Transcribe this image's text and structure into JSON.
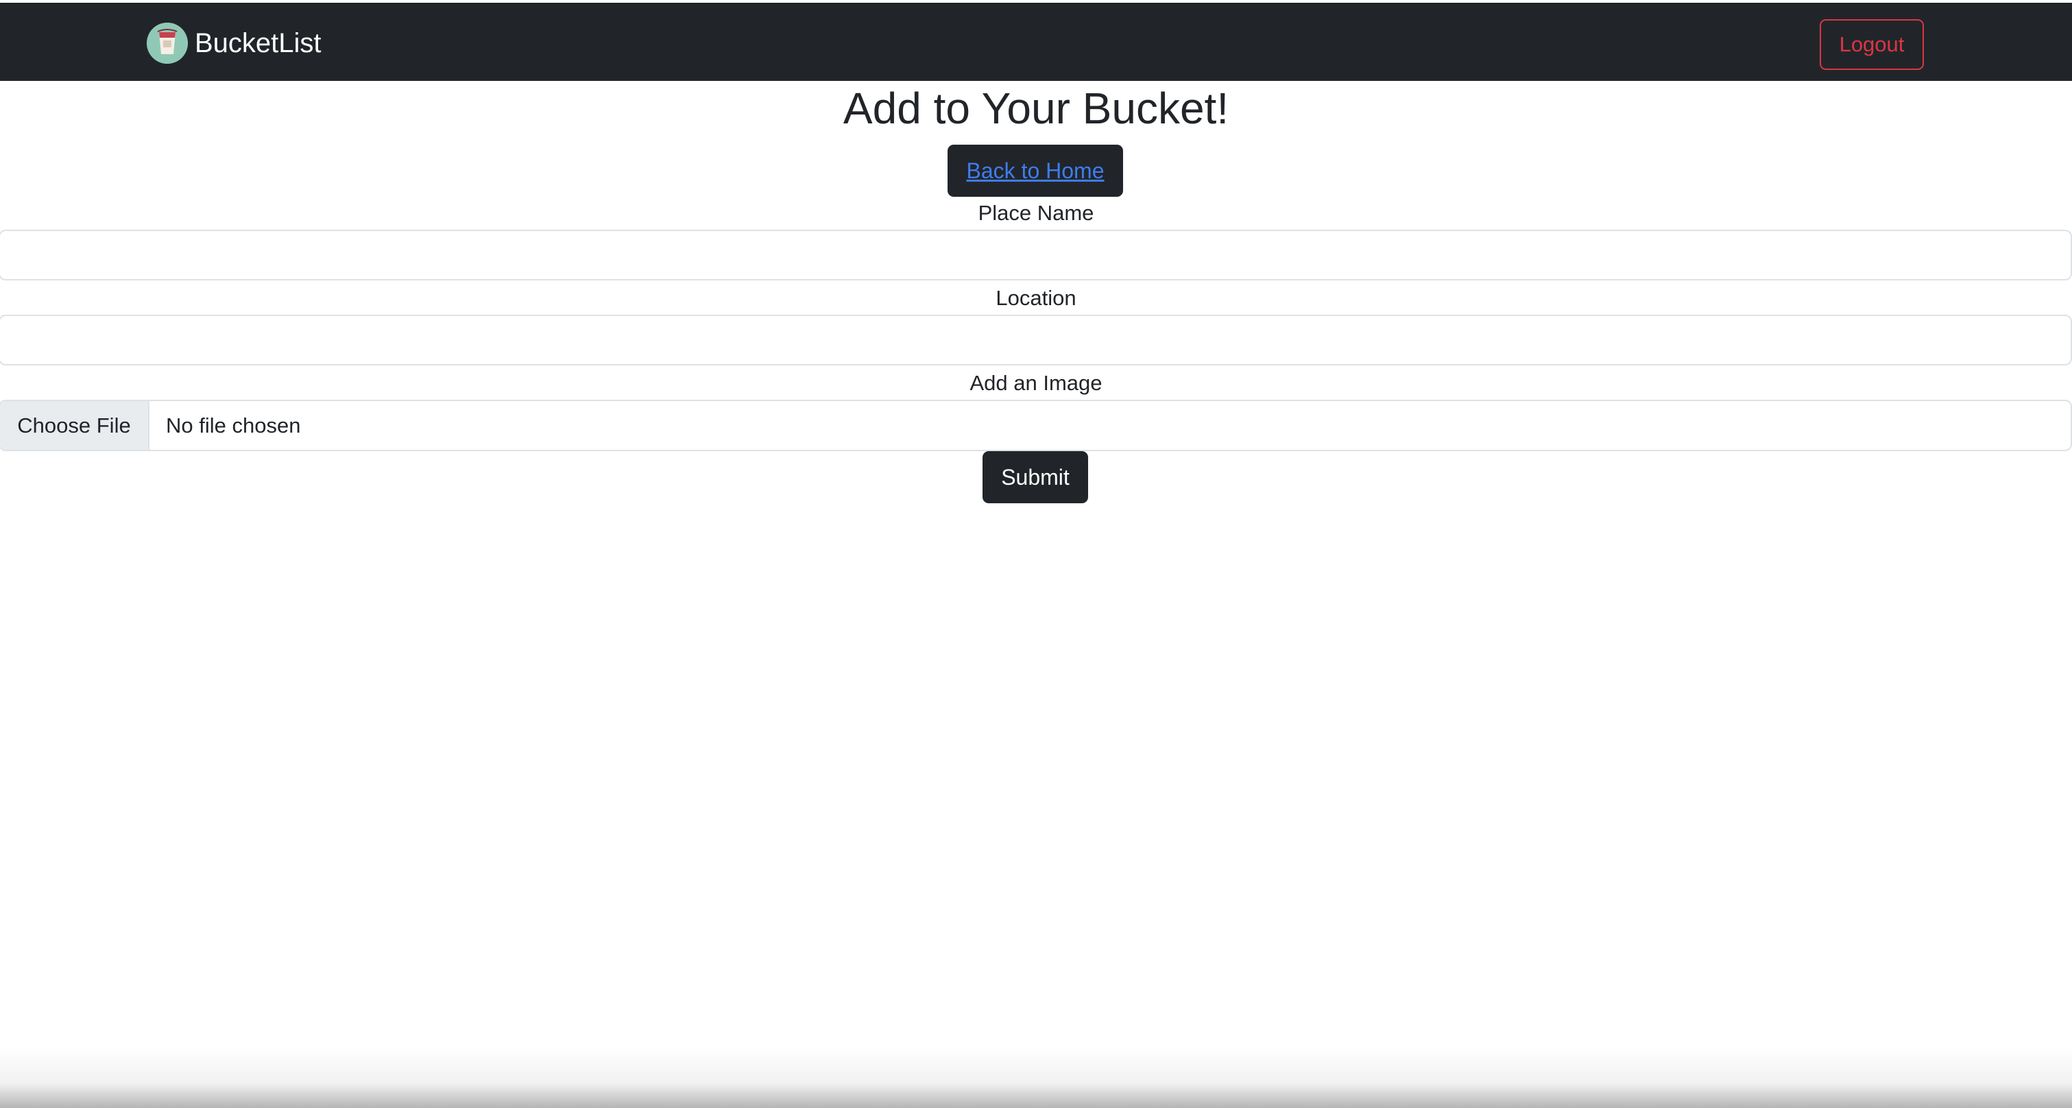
{
  "navbar": {
    "brand_name": "BucketList",
    "logout_label": "Logout"
  },
  "page": {
    "title": "Add to Your Bucket!",
    "back_home_label": "Back to Home"
  },
  "form": {
    "place_name_label": "Place Name",
    "place_name_value": "",
    "location_label": "Location",
    "location_value": "",
    "image_label": "Add an Image",
    "choose_file_label": "Choose File",
    "file_status": "No file chosen",
    "submit_label": "Submit"
  },
  "colors": {
    "navbar_bg": "#212529",
    "logout_red": "#dc3545",
    "link_blue": "#3f7cf0",
    "button_dark": "#212529"
  }
}
